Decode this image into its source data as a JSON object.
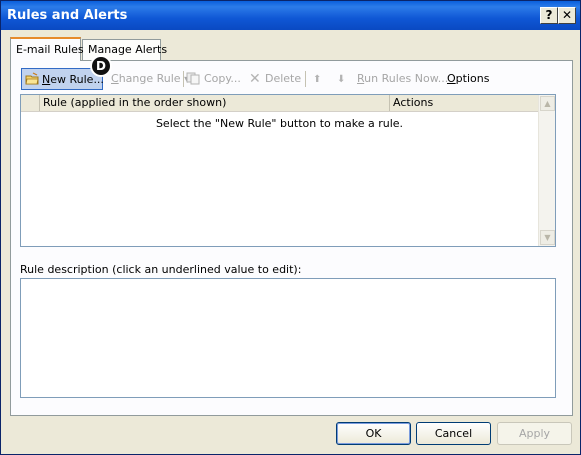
{
  "window": {
    "title": "Rules and Alerts",
    "help_label": "?",
    "close_label": "✕"
  },
  "tabs": [
    {
      "label": "E-mail Rules",
      "active": true
    },
    {
      "label": "Manage Alerts",
      "active": false
    }
  ],
  "toolbar": {
    "new_rule": {
      "underline": "N",
      "rest": "ew Rule...",
      "enabled": true
    },
    "change_rule": {
      "underline": "C",
      "rest": "hange Rule",
      "enabled": false
    },
    "copy": {
      "underline": "",
      "rest": "Copy...",
      "enabled": false
    },
    "delete": {
      "underline": "",
      "rest": "Delete",
      "enabled": false
    },
    "run_rules": {
      "underline": "R",
      "rest": "un Rules Now...",
      "enabled": false
    },
    "options": {
      "underline": "O",
      "rest": "ptions",
      "enabled": true
    }
  },
  "cursor_badge": "D",
  "rule_list": {
    "columns": [
      "",
      "Rule (applied in the order shown)",
      "Actions"
    ],
    "empty_message": "Select the \"New Rule\" button to make a rule."
  },
  "description": {
    "label": "Rule description (click an underlined value to edit):"
  },
  "buttons": {
    "ok": "OK",
    "cancel": "Cancel",
    "apply": "Apply"
  },
  "colors": {
    "titlebar": "#0a5fdc",
    "dialog_bg": "#ece9d8",
    "active_tab_accent": "#e68b2c",
    "hover_button": "#c1d2ee"
  }
}
